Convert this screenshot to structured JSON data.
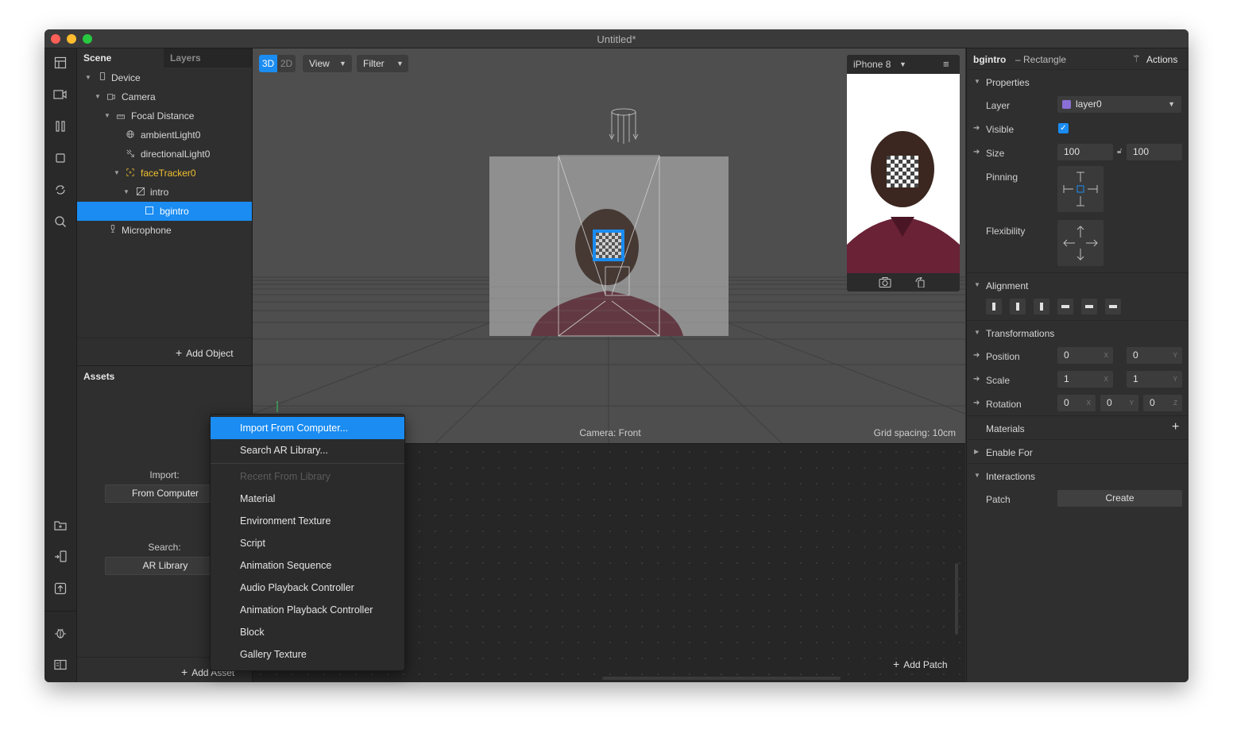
{
  "window": {
    "title": "Untitled*"
  },
  "scene_panel": {
    "tabs": [
      "Scene",
      "Layers"
    ],
    "tree": [
      {
        "label": "Device"
      },
      {
        "label": "Camera"
      },
      {
        "label": "Focal Distance"
      },
      {
        "label": "ambientLight0"
      },
      {
        "label": "directionalLight0"
      },
      {
        "label": "faceTracker0"
      },
      {
        "label": "intro"
      },
      {
        "label": "bgintro"
      },
      {
        "label": "Microphone"
      }
    ],
    "add_object": "Add Object"
  },
  "assets_panel": {
    "title": "Assets",
    "import_label": "Import:",
    "from_computer": "From Computer",
    "search_label": "Search:",
    "ar_library": "AR Library",
    "add_asset": "Add Asset"
  },
  "viewport": {
    "mode_3d": "3D",
    "mode_2d": "2D",
    "view": "View",
    "filter": "Filter",
    "camera_label": "Camera: Front",
    "grid_spacing": "Grid spacing: 10cm",
    "device": "iPhone 8"
  },
  "patch_editor": {
    "add_patch": "Add Patch"
  },
  "inspector": {
    "object_name": "bgintro",
    "object_type": "– Rectangle",
    "actions": "Actions",
    "properties": "Properties",
    "layer_label": "Layer",
    "layer_value": "layer0",
    "visible_label": "Visible",
    "size_label": "Size",
    "size_w": "100",
    "size_h": "100",
    "pinning_label": "Pinning",
    "flexibility_label": "Flexibility",
    "alignment": "Alignment",
    "transformations": "Transformations",
    "position_label": "Position",
    "position_x": "0",
    "position_y": "0",
    "scale_label": "Scale",
    "scale_x": "1",
    "scale_y": "1",
    "rotation_label": "Rotation",
    "rotation_x": "0",
    "rotation_y": "0",
    "rotation_z": "0",
    "axis_x": "X",
    "axis_y": "Y",
    "axis_z": "Z",
    "materials": "Materials",
    "enable_for": "Enable For",
    "interactions": "Interactions",
    "patch_label": "Patch",
    "create": "Create",
    "layer_color": "#8a6fd6"
  },
  "context_menu": {
    "items": [
      "Import From Computer...",
      "Search AR Library...",
      "Recent From Library",
      "Material",
      "Environment Texture",
      "Script",
      "Animation Sequence",
      "Audio Playback Controller",
      "Animation Playback Controller",
      "Block",
      "Gallery Texture"
    ]
  },
  "colors": {
    "accent": "#1a8cf2",
    "tracker": "#f0c030"
  }
}
